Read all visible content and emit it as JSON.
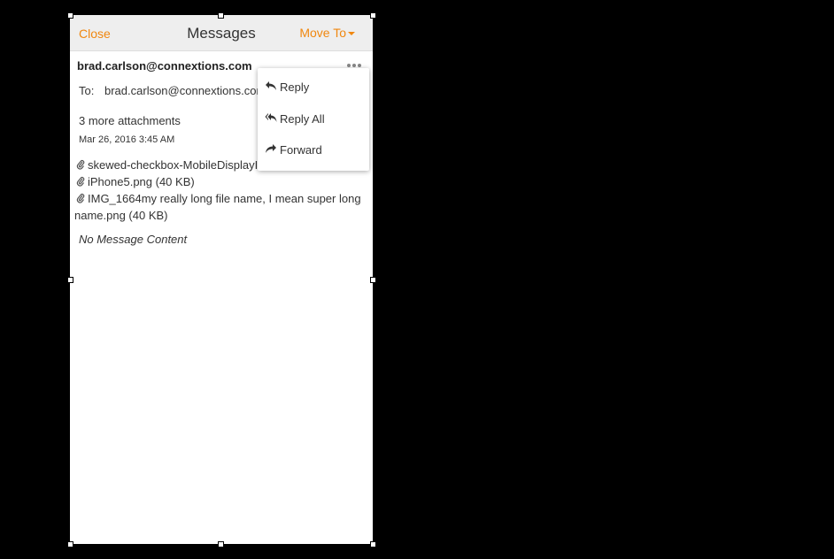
{
  "header": {
    "close_label": "Close",
    "title": "Messages",
    "move_to_label": "Move To"
  },
  "message": {
    "from": "brad.carlson@connextions.com",
    "to_label": "To:",
    "to_value": "brad.carlson@connextions.com",
    "more_attachments": "3 more attachments",
    "date": "Mar 26, 2016 3:45 AM",
    "attachments": [
      {
        "name": "skewed-checkbox-MobileDisplayIn"
      },
      {
        "name": "iPhone5.png (40 KB)"
      },
      {
        "name": "IMG_1664my really long file name, I mean super long name.png (40 KB)"
      }
    ],
    "body": "No Message Content"
  },
  "menu": {
    "items": [
      {
        "label": "Reply",
        "icon": "reply-icon"
      },
      {
        "label": "Reply All",
        "icon": "reply-all-icon"
      },
      {
        "label": "Forward",
        "icon": "forward-icon"
      }
    ]
  },
  "colors": {
    "accent": "#f0870f",
    "header_bg": "#eeeeee",
    "page_bg": "#000000"
  }
}
